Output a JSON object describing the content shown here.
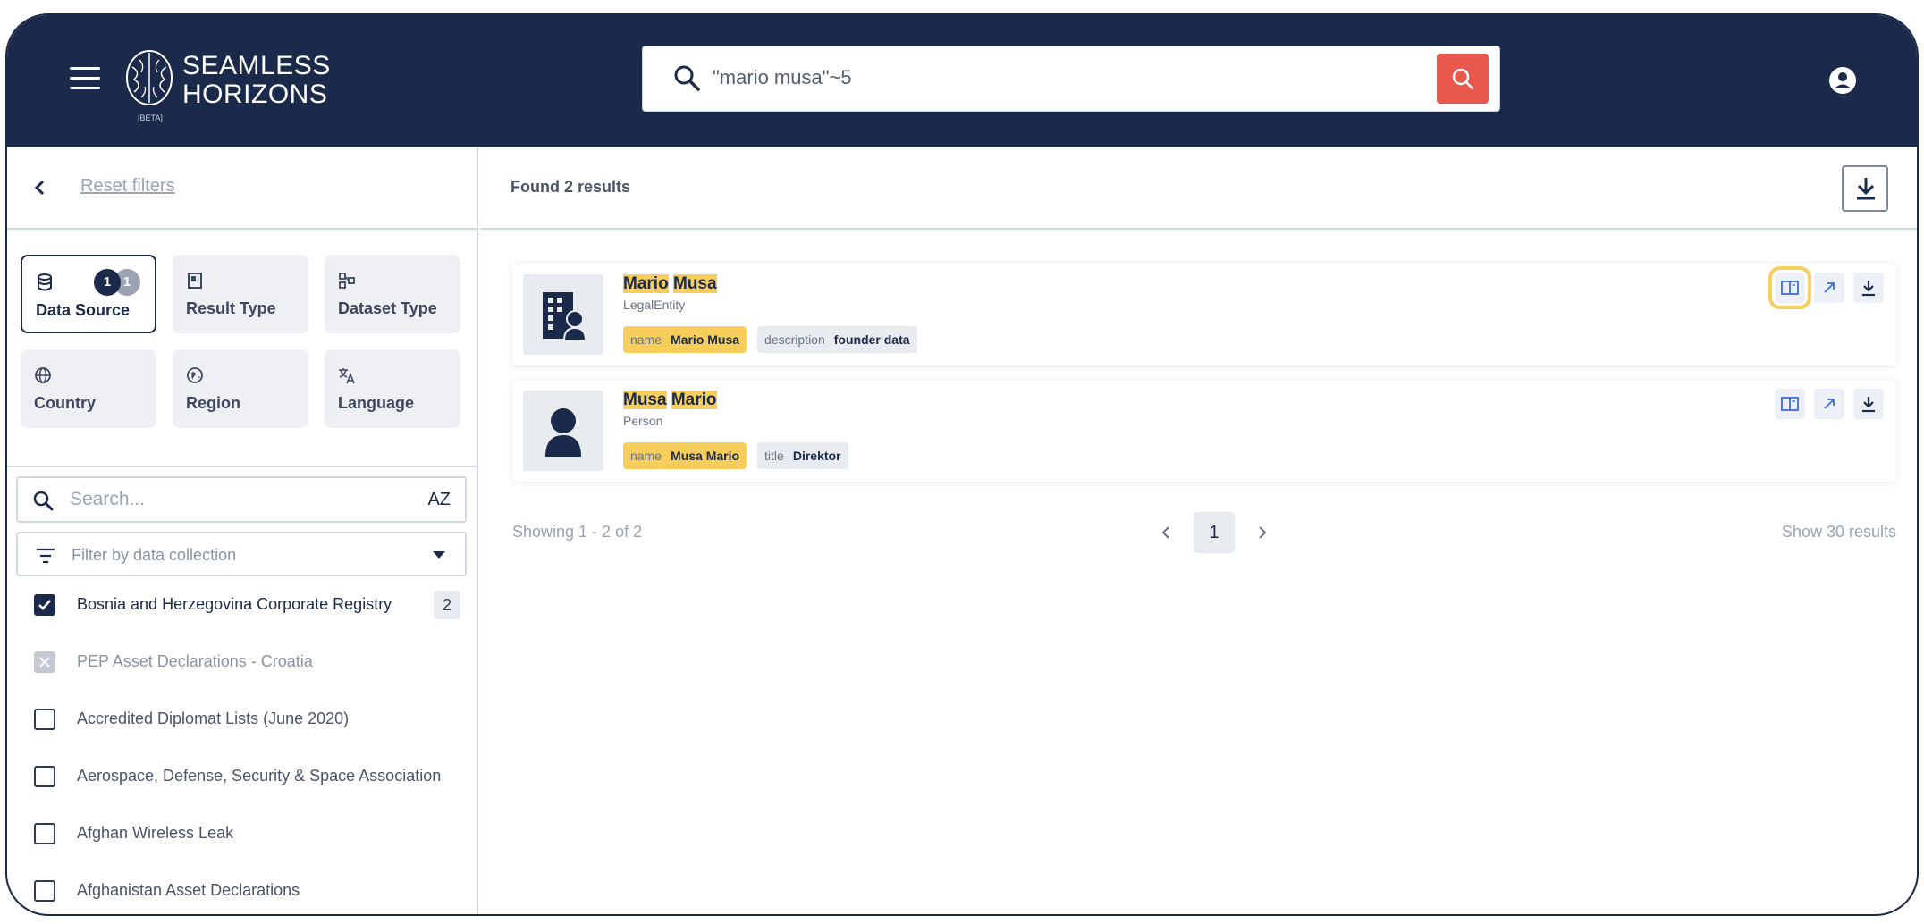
{
  "header": {
    "logo_line1": "SEAMLESS",
    "logo_line2": "HORIZONS",
    "logo_beta": "[BETA]",
    "search_query": "\"mario musa\"~5"
  },
  "sidebar": {
    "reset_label": "Reset filters",
    "facets": [
      {
        "label": "Data Source",
        "icon": "database-icon",
        "badge_included": "1",
        "badge_excluded": "1",
        "active": true
      },
      {
        "label": "Result Type",
        "icon": "bookmark-icon"
      },
      {
        "label": "Dataset Type",
        "icon": "diagram-icon"
      },
      {
        "label": "Country",
        "icon": "globe-icon"
      },
      {
        "label": "Region",
        "icon": "region-icon"
      },
      {
        "label": "Language",
        "icon": "translate-icon"
      }
    ],
    "search_placeholder": "Search...",
    "sort_label": "AZ",
    "collection_placeholder": "Filter by data collection",
    "datasets": [
      {
        "label": "Bosnia and Herzegovina Corporate Registry",
        "state": "checked",
        "count": "2"
      },
      {
        "label": "PEP Asset Declarations - Croatia",
        "state": "excluded"
      },
      {
        "label": "Accredited Diplomat Lists (June 2020)",
        "state": "unchecked"
      },
      {
        "label": "Aerospace, Defense, Security & Space Association",
        "state": "unchecked"
      },
      {
        "label": "Afghan Wireless Leak",
        "state": "unchecked"
      },
      {
        "label": "Afghanistan Asset Declarations",
        "state": "unchecked"
      }
    ]
  },
  "main": {
    "found_text": "Found 2 results",
    "results": [
      {
        "title_part1": "Mario",
        "title_part2": "Musa",
        "type": "LegalEntity",
        "icon": "building-icon",
        "chips": [
          {
            "key": "name",
            "value": "Mario Musa",
            "highlight": true
          },
          {
            "key": "description",
            "value": "founder data",
            "highlight": false
          }
        ]
      },
      {
        "title_part1": "Musa",
        "title_part2": "Mario",
        "type": "Person",
        "icon": "person-icon",
        "chips": [
          {
            "key": "name",
            "value": "Musa Mario",
            "highlight": true
          },
          {
            "key": "title",
            "value": "Direktor",
            "highlight": false
          }
        ]
      }
    ],
    "pagination": {
      "showing": "Showing 1 - 2 of 2",
      "current_page": "1",
      "per_page": "Show 30 results"
    }
  },
  "colors": {
    "navy": "#1b2a4a",
    "accent_red": "#e8584d",
    "highlight_yellow": "#f7ce5b"
  }
}
